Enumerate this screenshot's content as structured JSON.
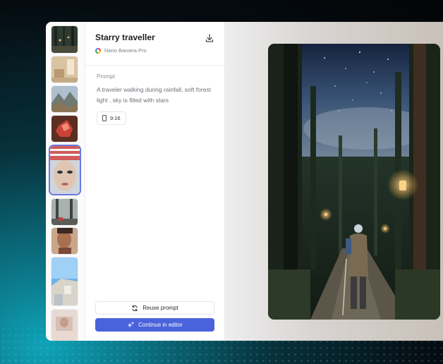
{
  "generation": {
    "title": "Starry traveller",
    "model": "Nano Banana Pro",
    "prompt_label": "Prompt",
    "prompt_text": "A traveler walking during rainfall, soft forest light , sky is filled with stars",
    "aspect_ratio": "9:16"
  },
  "actions": {
    "reuse_label": "Reuse prompt",
    "continue_label": "Continue in editor"
  },
  "colors": {
    "accent": "#4a62dc",
    "selected_outline": "#6a78e0"
  },
  "icons": [
    "download-icon",
    "google-logo-icon",
    "phone-ratio-icon",
    "refresh-icon",
    "sparkle-icon"
  ]
}
